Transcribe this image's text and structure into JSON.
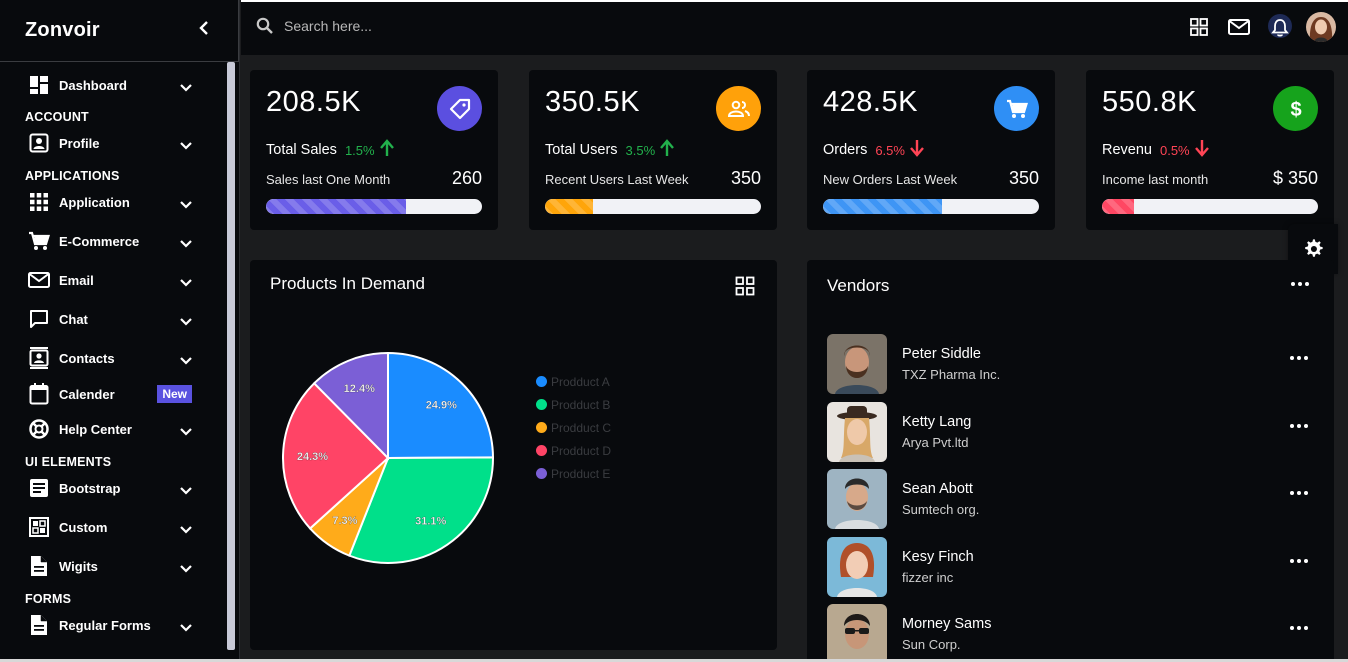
{
  "brand": {
    "name": "Zonvoir"
  },
  "search": {
    "placeholder": "Search here..."
  },
  "sidebar": {
    "items": [
      {
        "type": "item",
        "label": "Dashboard",
        "icon": "dashboard-icon"
      },
      {
        "type": "section",
        "label": "ACCOUNT"
      },
      {
        "type": "item",
        "label": "Profile",
        "icon": "profile-icon"
      },
      {
        "type": "section",
        "label": "APPLICATIONS"
      },
      {
        "type": "item",
        "label": "Application",
        "icon": "apps-grid-icon"
      },
      {
        "type": "item",
        "label": "E-Commerce",
        "icon": "cart-icon"
      },
      {
        "type": "item",
        "label": "Email",
        "icon": "mail-icon"
      },
      {
        "type": "item",
        "label": "Chat",
        "icon": "chat-icon"
      },
      {
        "type": "item",
        "label": "Contacts",
        "icon": "contacts-icon"
      },
      {
        "type": "item",
        "label": "Calender",
        "icon": "calendar-icon",
        "badge": "New"
      },
      {
        "type": "item",
        "label": "Help Center",
        "icon": "help-icon"
      },
      {
        "type": "section",
        "label": "UI ELEMENTS"
      },
      {
        "type": "item",
        "label": "Bootstrap",
        "icon": "bootstrap-icon"
      },
      {
        "type": "item",
        "label": "Custom",
        "icon": "custom-icon"
      },
      {
        "type": "item",
        "label": "Wigits",
        "icon": "document-icon"
      },
      {
        "type": "section",
        "label": "FORMS"
      },
      {
        "type": "item",
        "label": "Regular Forms",
        "icon": "document-icon"
      }
    ]
  },
  "stats": [
    {
      "value": "208.5K",
      "label": "Total Sales",
      "pct": "1.5%",
      "trend": "up",
      "sub": "Sales last One Month",
      "subval": "260",
      "progress": 0.65,
      "color": "#6a5ee8",
      "icon": "tag-icon"
    },
    {
      "value": "350.5K",
      "label": "Total Users",
      "pct": "3.5%",
      "trend": "up",
      "sub": "Recent Users Last Week",
      "subval": "350",
      "progress": 0.22,
      "color": "#ffa50a",
      "icon": "users-icon"
    },
    {
      "value": "428.5K",
      "label": "Orders",
      "pct": "6.5%",
      "trend": "down",
      "sub": "New Orders Last Week",
      "subval": "350",
      "progress": 0.55,
      "color": "#3e95f5",
      "icon": "cart-icon"
    },
    {
      "value": "550.8K",
      "label": "Revenu",
      "pct": "0.5%",
      "trend": "down",
      "sub": "Income last month",
      "subval": "$ 350",
      "progress": 0.15,
      "color": "#ff4763",
      "icon": "dollar-icon"
    }
  ],
  "colors": {
    "up": "#22b14c",
    "down": "#ff4455",
    "sales_icon_bg": "#5b4fe0",
    "users_icon_bg": "#ffa10a",
    "orders_icon_bg": "#2f8ff5",
    "revenue_icon_bg": "#16a31c"
  },
  "products": {
    "title": "Products In Demand"
  },
  "chart_data": {
    "type": "pie",
    "title": "Products In Demand",
    "categories": [
      "Prodduct A",
      "Prodduct B",
      "Prodduct C",
      "Prodduct D",
      "Prodduct E"
    ],
    "values": [
      24.9,
      31.1,
      7.3,
      24.3,
      12.4
    ],
    "labels": [
      "24.9%",
      "31.1%",
      "7.3%",
      "24.3%",
      "12.4%"
    ],
    "colors": [
      "#1a8cff",
      "#00e08a",
      "#ffab1a",
      "#ff4466",
      "#7b5fd6"
    ],
    "legend": "right"
  },
  "vendors": {
    "title": "Vendors",
    "items": [
      {
        "name": "Peter Siddle",
        "org": "TXZ Pharma Inc."
      },
      {
        "name": "Ketty Lang",
        "org": "Arya Pvt.ltd"
      },
      {
        "name": "Sean Abott",
        "org": "Sumtech org."
      },
      {
        "name": "Kesy Finch",
        "org": "fizzer inc"
      },
      {
        "name": "Morney Sams",
        "org": "Sun Corp."
      }
    ]
  }
}
